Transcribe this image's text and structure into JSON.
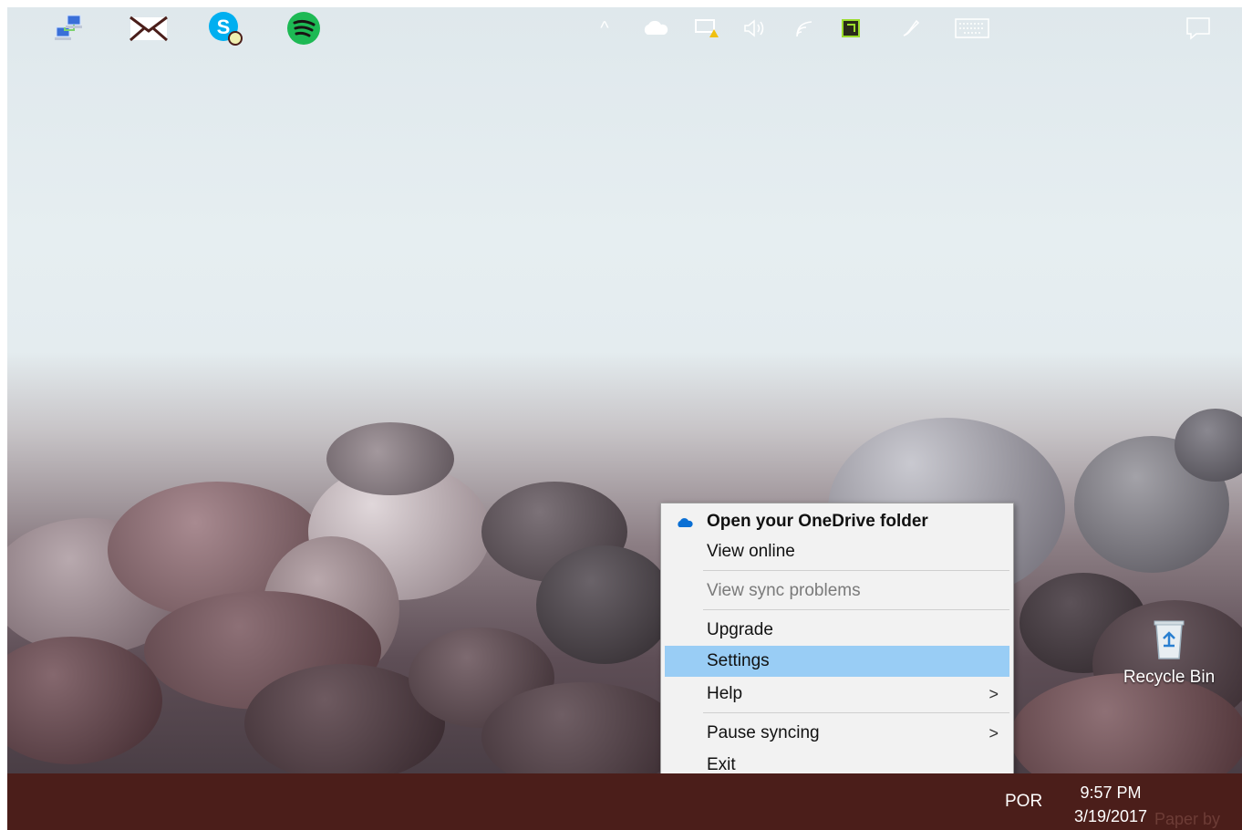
{
  "menu": {
    "items": [
      {
        "label": "Open your OneDrive folder"
      },
      {
        "label": "View online"
      },
      {
        "label": "View sync problems"
      },
      {
        "label": "Upgrade"
      },
      {
        "label": "Settings"
      },
      {
        "label": "Help"
      },
      {
        "label": "Pause syncing"
      },
      {
        "label": "Exit"
      }
    ],
    "submenu_arrow": ">"
  },
  "desktop": {
    "recycle_bin_label": "Recycle Bin"
  },
  "taskbar": {
    "pinned_apps": [
      "network-connections-icon",
      "mail-icon",
      "skype-icon",
      "spotify-icon"
    ],
    "tray": {
      "language": "POR",
      "time": "9:57 PM",
      "date": "3/19/2017",
      "overflow_glyph": "^"
    },
    "wallpaper_credit": "Paper by"
  },
  "colors": {
    "taskbar": "#4b1e1a",
    "menu_highlight": "#99cdf5",
    "onedrive_blue": "#0a6fd4",
    "spotify_green": "#1db954",
    "skype_blue": "#00aff0"
  }
}
